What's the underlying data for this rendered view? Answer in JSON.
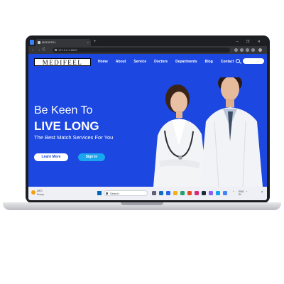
{
  "browser": {
    "tab_title": "MEDIFEEL",
    "tab_close": "×",
    "new_tab": "+",
    "window_controls": "– ❐ ✕",
    "url": "127.0.0.1:5500",
    "nav_back": "←",
    "nav_forward": "→",
    "nav_reload": "C",
    "nav_home": "⌂"
  },
  "site": {
    "logo": "MEDIFEEL",
    "menu": [
      "Home",
      "About",
      "Service",
      "Doctors",
      "Departments",
      "Blog",
      "Contact"
    ],
    "search_placeholder": ""
  },
  "hero": {
    "line1": "Be Keen To",
    "line2": "LIVE LONG",
    "line3": "The Best Match Services For You",
    "learn_more": "Learn More",
    "sign_in": "Sign In"
  },
  "taskbar": {
    "weather_temp": "29°C",
    "weather_desc": "Sunny",
    "search_label": "Search",
    "tray_lang": "ENG\nIN",
    "clock_time": "",
    "clock_date": ""
  },
  "colors": {
    "brand_blue": "#1c47e0",
    "signin_blue": "#1aa7f0"
  }
}
